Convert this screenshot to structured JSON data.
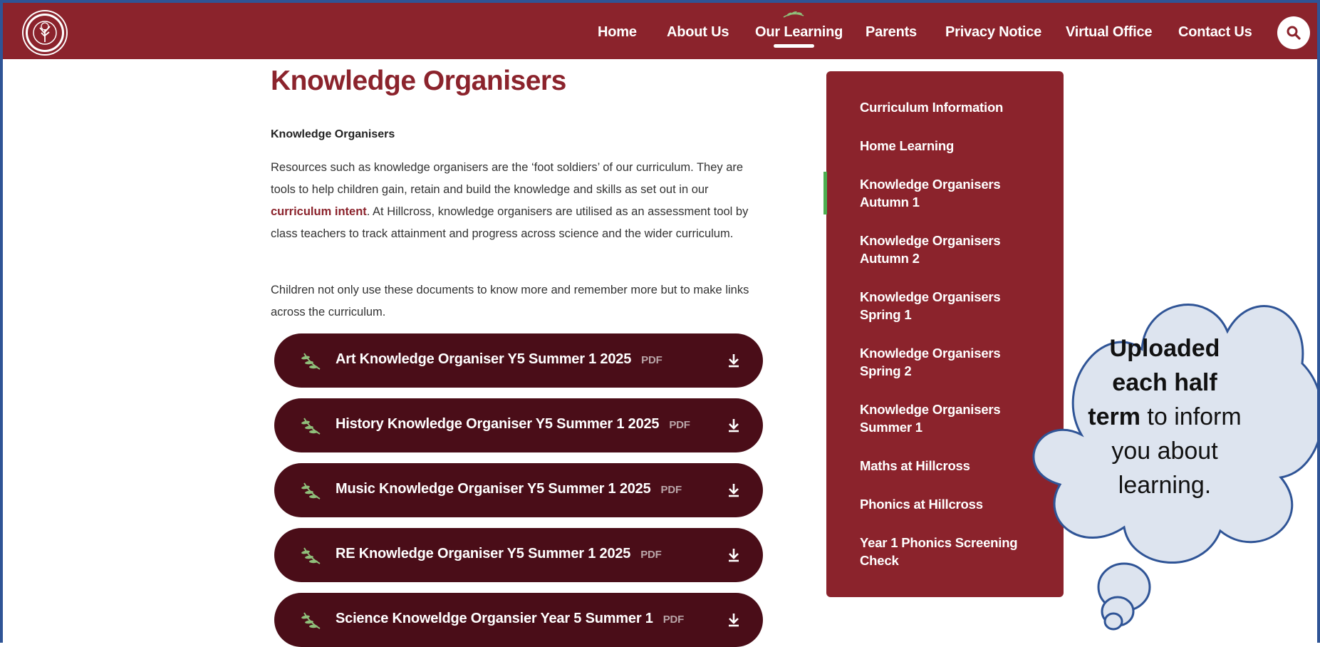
{
  "header": {
    "nav": [
      {
        "label": "Home"
      },
      {
        "label": "About Us"
      },
      {
        "label": "Our Learning"
      },
      {
        "label": "Parents"
      },
      {
        "label": "Privacy Notice"
      },
      {
        "label": "Virtual Office"
      },
      {
        "label": "Contact Us"
      }
    ],
    "active_nav": "Our Learning",
    "logo_text": "HILLCROSS PRIMARY",
    "search_icon": "search-icon"
  },
  "main": {
    "title": "Knowledge Organisers",
    "subheading": "Knowledge Organisers",
    "para1_part1": "Resources such as knowledge organisers are the ‘foot soldiers’ of our curriculum. They are tools to help children gain, retain and build the knowledge and skills as set out in our ",
    "para1_link": "curriculum intent",
    "para1_part2": ".  At Hillcross, knowledge organisers are utilised as an assessment tool by class teachers to track attainment and progress across science and the wider curriculum.",
    "para2": "Children not only use these documents to know more and remember more but to make links across the curriculum.",
    "documents": [
      {
        "title": "Art Knowledge Organiser Y5 Summer 1 2025",
        "type": "PDF"
      },
      {
        "title": "History Knowledge Organiser Y5 Summer 1 2025",
        "type": "PDF"
      },
      {
        "title": "Music Knowledge Organiser Y5 Summer 1 2025",
        "type": "PDF"
      },
      {
        "title": "RE Knowledge Organiser Y5 Summer 1 2025",
        "type": "PDF"
      },
      {
        "title": "Science Knoweldge Organsier Year 5 Summer 1",
        "type": "PDF"
      }
    ]
  },
  "sidebar": {
    "items": [
      {
        "label": "Curriculum Information"
      },
      {
        "label": "Home Learning"
      },
      {
        "label": "Knowledge Organisers Autumn 1"
      },
      {
        "label": "Knowledge Organisers Autumn 2"
      },
      {
        "label": "Knowledge Organisers Spring 1"
      },
      {
        "label": "Knowledge Organisers Spring 2"
      },
      {
        "label": "Knowledge Organisers Summer 1"
      },
      {
        "label": "Maths at Hillcross"
      },
      {
        "label": "Phonics at Hillcross"
      },
      {
        "label": "Year 1 Phonics Screening Check"
      }
    ]
  },
  "callout": {
    "bold": "Uploaded each half term",
    "rest": " to inform you about learning."
  },
  "colors": {
    "brand": "#8b232c",
    "button": "#4a0d18",
    "active_marker": "#4caf50"
  }
}
